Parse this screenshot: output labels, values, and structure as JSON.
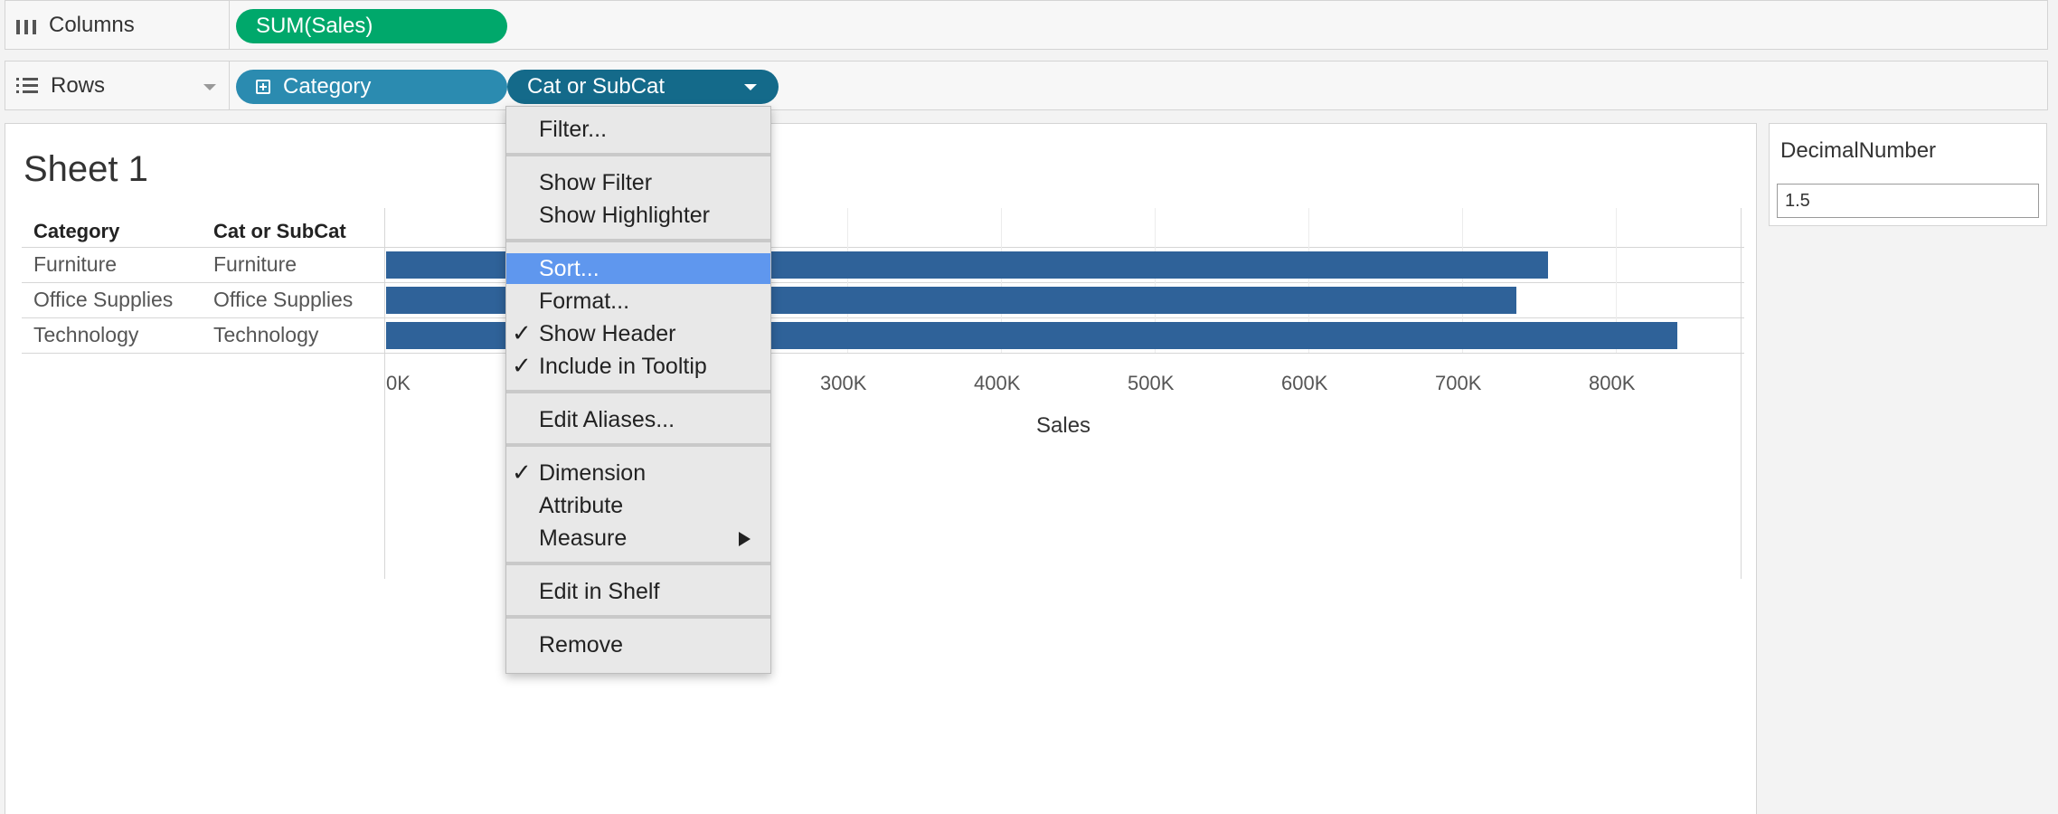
{
  "columns_shelf": {
    "label": "Columns",
    "pills": [
      {
        "label": "SUM(Sales)"
      }
    ]
  },
  "rows_shelf": {
    "label": "Rows",
    "pills": [
      {
        "label": "Category"
      },
      {
        "label": "Cat or SubCat"
      }
    ]
  },
  "sheet": {
    "title": "Sheet 1",
    "headers": [
      "Category",
      "Cat or SubCat"
    ],
    "rows": [
      {
        "category": "Furniture",
        "cat_or_subcat": "Furniture"
      },
      {
        "category": "Office Supplies",
        "cat_or_subcat": "Office Supplies"
      },
      {
        "category": "Technology",
        "cat_or_subcat": "Technology"
      }
    ]
  },
  "chart_data": {
    "type": "bar",
    "orientation": "horizontal",
    "categories": [
      "Furniture",
      "Office Supplies",
      "Technology"
    ],
    "values": [
      756000,
      735000,
      840000
    ],
    "xlabel": "Sales",
    "ylabel": "",
    "xlim": [
      0,
      880000
    ],
    "x_ticks": [
      "0K",
      "300K",
      "400K",
      "500K",
      "600K",
      "700K",
      "800K"
    ],
    "bar_color": "#2f6299",
    "grid": true
  },
  "parameter": {
    "title": "DecimalNumber",
    "value": "1.5"
  },
  "context_menu": {
    "items": [
      {
        "label": "Filter...",
        "checked": false,
        "highlighted": false
      },
      {
        "label": "Show Filter",
        "checked": false,
        "highlighted": false
      },
      {
        "label": "Show Highlighter",
        "checked": false,
        "highlighted": false
      },
      {
        "label": "Sort...",
        "checked": false,
        "highlighted": true
      },
      {
        "label": "Format...",
        "checked": false,
        "highlighted": false
      },
      {
        "label": "Show Header",
        "checked": true,
        "highlighted": false
      },
      {
        "label": "Include in Tooltip",
        "checked": true,
        "highlighted": false
      },
      {
        "label": "Edit Aliases...",
        "checked": false,
        "highlighted": false
      },
      {
        "label": "Dimension",
        "checked": true,
        "highlighted": false
      },
      {
        "label": "Attribute",
        "checked": false,
        "highlighted": false
      },
      {
        "label": "Measure",
        "checked": false,
        "highlighted": false,
        "submenu": true
      },
      {
        "label": "Edit in Shelf",
        "checked": false,
        "highlighted": false
      },
      {
        "label": "Remove",
        "checked": false,
        "highlighted": false
      }
    ],
    "check_glyph": "✓",
    "highlight_color": "#5f97ee"
  },
  "colors": {
    "pill_measure": "#00a86b",
    "pill_dimension": "#2b8bb0",
    "pill_active": "#146a8a"
  }
}
